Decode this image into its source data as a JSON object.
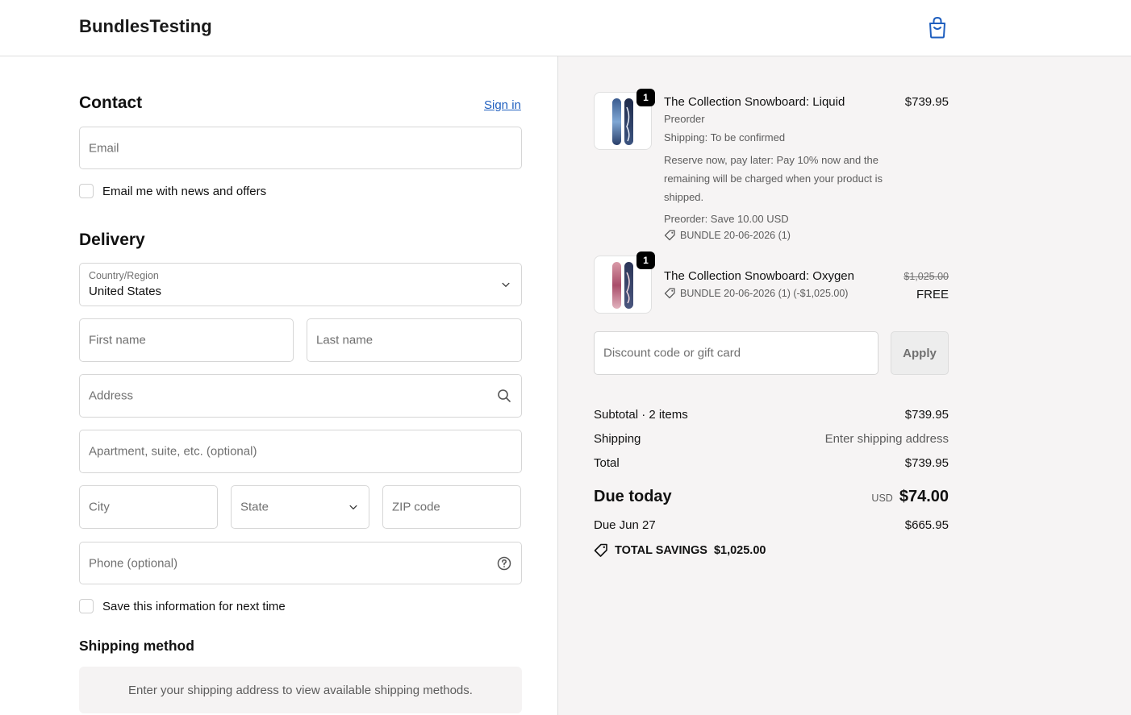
{
  "header": {
    "brand": "BundlesTesting",
    "cart_icon": "shopping-bag-icon"
  },
  "contact": {
    "title": "Contact",
    "sign_in": "Sign in",
    "email_placeholder": "Email",
    "news_checkbox": "Email me with news and offers"
  },
  "delivery": {
    "title": "Delivery",
    "country_label": "Country/Region",
    "country_value": "United States",
    "first_name": "First name",
    "last_name": "Last name",
    "address": "Address",
    "apartment": "Apartment, suite, etc. (optional)",
    "city": "City",
    "state": "State",
    "zip": "ZIP code",
    "phone": "Phone (optional)",
    "save_info": "Save this information for next time"
  },
  "shipping_method": {
    "title": "Shipping method",
    "message": "Enter your shipping address to view available shipping methods."
  },
  "order": {
    "items": [
      {
        "title": "The Collection Snowboard: Liquid",
        "quantity": "1",
        "price": "$739.95",
        "variant": "Preorder",
        "shipping": "Shipping: To be confirmed",
        "note": "Reserve now, pay later: Pay 10% now and the remaining will be charged when your product is shipped.",
        "discount_note": "Preorder: Save 10.00 USD",
        "bundle_tag": "BUNDLE 20-06-2026 (1)"
      },
      {
        "title": "The Collection Snowboard: Oxygen",
        "quantity": "1",
        "original_price": "$1,025.00",
        "price": "FREE",
        "bundle_tag": "BUNDLE 20-06-2026 (1) (-$1,025.00)"
      }
    ],
    "discount_placeholder": "Discount code or gift card",
    "apply_label": "Apply"
  },
  "summary": {
    "subtotal_label": "Subtotal · 2 items",
    "subtotal_value": "$739.95",
    "shipping_label": "Shipping",
    "shipping_value": "Enter shipping address",
    "total_label": "Total",
    "total_value": "$739.95",
    "due_today_label": "Due today",
    "due_today_currency": "USD",
    "due_today_value": "$74.00",
    "due_later_label": "Due Jun 27",
    "due_later_value": "$665.95",
    "savings_label": "TOTAL SAVINGS",
    "savings_value": "$1,025.00"
  },
  "colors": {
    "link": "#1f5fbf",
    "brand_icon": "#1f5fbf",
    "panel_bg": "#f6f4f4"
  }
}
